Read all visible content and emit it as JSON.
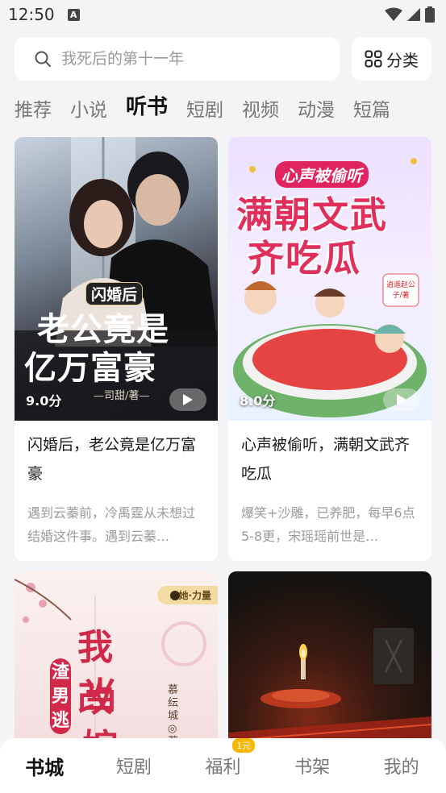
{
  "status_bar": {
    "time": "12:50",
    "app_icon_letter": "A",
    "icons": [
      "wifi-icon",
      "signal-icon",
      "battery-icon"
    ]
  },
  "search": {
    "placeholder": "我死后的第十一年"
  },
  "category_button": {
    "label": "分类",
    "icon": "grid-icon"
  },
  "tabs": [
    {
      "label": "推荐",
      "active": false
    },
    {
      "label": "小说",
      "active": false
    },
    {
      "label": "听书",
      "active": true
    },
    {
      "label": "短剧",
      "active": false
    },
    {
      "label": "视频",
      "active": false
    },
    {
      "label": "动漫",
      "active": false
    },
    {
      "label": "短篇",
      "active": false
    }
  ],
  "cards": [
    {
      "cover_text": {
        "tag": "闪婚后",
        "line1": "老公竟是",
        "line2": "亿万富豪",
        "author": "—司甜/著—"
      },
      "rating": "9.0分",
      "title": "闪婚后，老公竟是亿万富豪",
      "description": "遇到云蓁前，冷禹霆从未想过结婚这件事。遇到云蓁…"
    },
    {
      "cover_text": {
        "tag": "心声被偷听",
        "line1": "满朝文武",
        "line2": "齐吃瓜",
        "author": "逍遥赵公子/著"
      },
      "rating": "8.0分",
      "title": "心声被偷听，满朝文武齐吃瓜",
      "description": "爆笑+沙雕，已养肥，每早6点5-8更，宋瑶瑶前世是…"
    },
    {
      "cover_text": {
        "badge": "她·力量",
        "line1": "我改",
        "line2": "当嫁",
        "side": "渣男逃",
        "author": "慕纭城◎著"
      }
    },
    {
      "cover_text": {}
    }
  ],
  "bottom_nav": [
    {
      "label": "书城",
      "active": true
    },
    {
      "label": "短剧",
      "active": false
    },
    {
      "label": "福利",
      "active": false,
      "badge": "1元"
    },
    {
      "label": "书架",
      "active": false
    },
    {
      "label": "我的",
      "active": false
    }
  ]
}
